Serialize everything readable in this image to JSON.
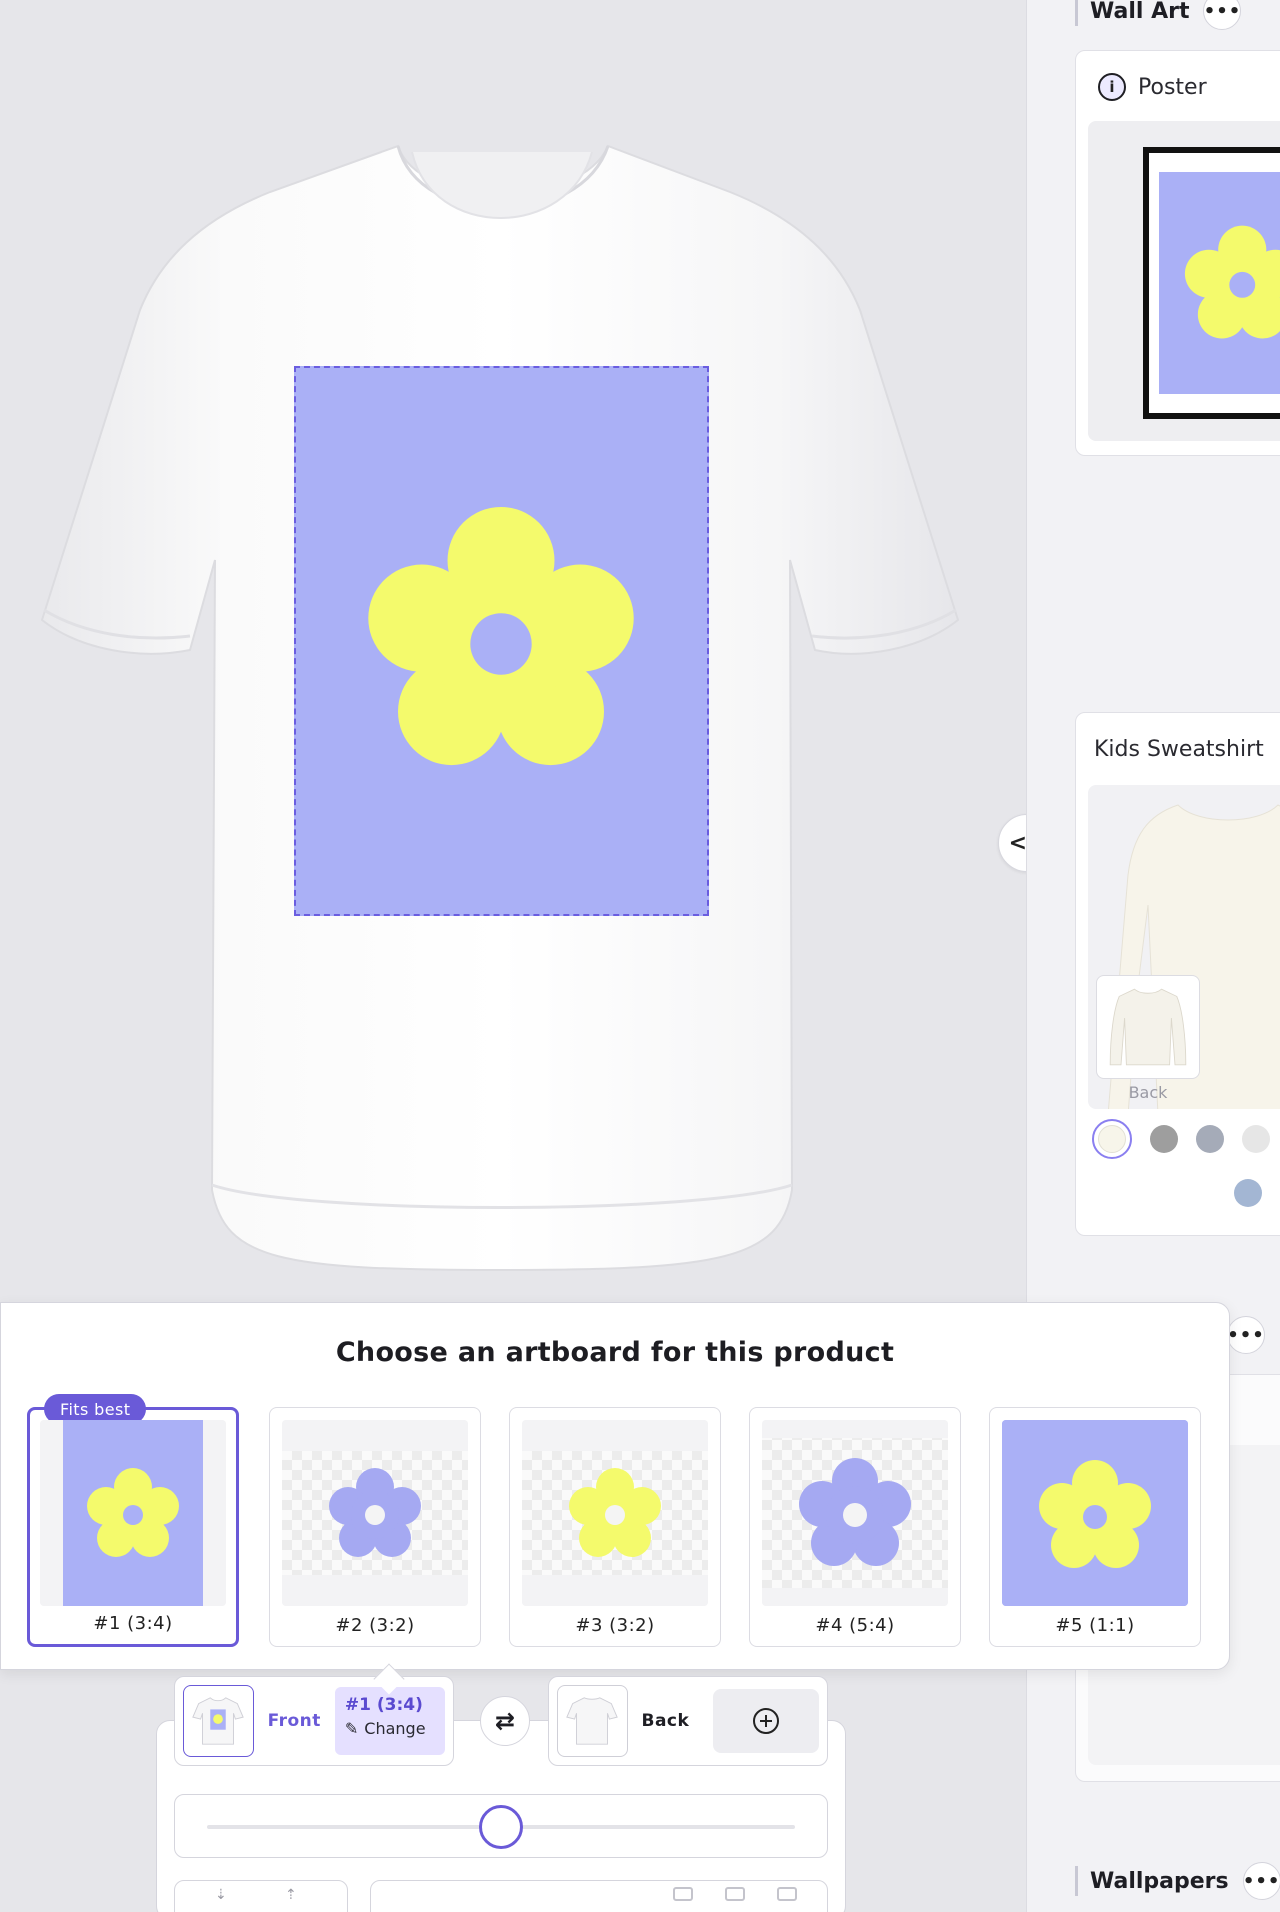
{
  "colors": {
    "accent": "#6a5ad8",
    "artboard_bg": "#aab0f6",
    "flower_yellow": "#f4fa6c",
    "flower_lavender": "#a5a9f2",
    "panel_bg": "#f2f2f5"
  },
  "canvas": {
    "product": "t-shirt",
    "artboard_outline": "#1 (3:4)"
  },
  "right_panel": {
    "wall_art_title": "Wall Art",
    "poster_title": "Poster",
    "kids_sweatshirt_title": "Kids Sweatshirt",
    "back_label": "Back",
    "wallpapers_title": "Wallpapers",
    "more_icon": "more-dots-icon",
    "swatches": [
      "#f7f5ea",
      "#9e9e9e",
      "#a5abb8",
      "#e6e6e6",
      "#a3b6d3"
    ]
  },
  "chooser": {
    "title": "Choose an artboard for this product",
    "fits_best_label": "Fits best",
    "artboards": [
      {
        "label": "#1 (3:4)",
        "selected": true
      },
      {
        "label": "#2 (3:2)",
        "selected": false
      },
      {
        "label": "#3 (3:2)",
        "selected": false
      },
      {
        "label": "#4 (5:4)",
        "selected": false
      },
      {
        "label": "#5 (1:1)",
        "selected": false
      }
    ]
  },
  "toolbar": {
    "front_label": "Front",
    "artboard_label": "#1 (3:4)",
    "change_label": "Change",
    "back_label": "Back",
    "swap_icon": "swap-arrows-icon",
    "add_icon": "plus-circle-icon",
    "scale_slider": 0.5
  }
}
